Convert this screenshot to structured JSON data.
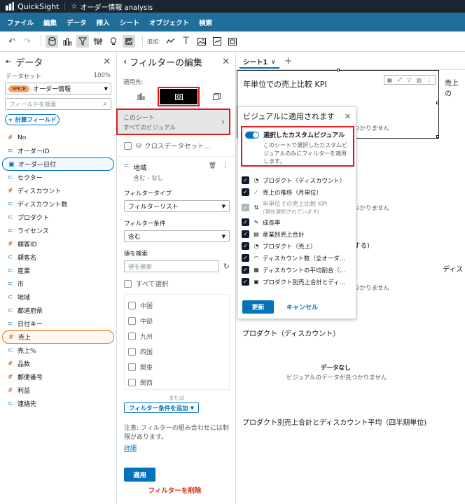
{
  "app": {
    "brand": "QuickSight",
    "analysis_title": "オーダー情報 analysis"
  },
  "menu": [
    "ファイル",
    "編集",
    "データ",
    "挿入",
    "シート",
    "オブジェクト",
    "検索"
  ],
  "toolbar": {
    "add_label": "追加:"
  },
  "data_pane": {
    "title": "データ",
    "dataset_label": "データセット",
    "dataset_pct": "100%",
    "spice_badge": "SPICE",
    "dataset_name": "オーダー情報",
    "search_placeholder": "フィールドを検索",
    "calc_button": "+ 計算フィールド",
    "fields": [
      {
        "type": "#",
        "name": "No"
      },
      {
        "type": "dim",
        "name": "オーダーID"
      },
      {
        "type": "date",
        "name": "オーダー日付",
        "selected": "blue"
      },
      {
        "type": "dim",
        "name": "セクター"
      },
      {
        "type": "#",
        "name": "ディスカウント"
      },
      {
        "type": "dim",
        "name": "ディスカウント数"
      },
      {
        "type": "dim",
        "name": "プロダクト"
      },
      {
        "type": "dim",
        "name": "ライセンス"
      },
      {
        "type": "#",
        "name": "顧客ID"
      },
      {
        "type": "dim",
        "name": "顧客名"
      },
      {
        "type": "dim",
        "name": "産業"
      },
      {
        "type": "dim",
        "name": "市"
      },
      {
        "type": "dim",
        "name": "地域"
      },
      {
        "type": "dim",
        "name": "都道府県"
      },
      {
        "type": "dim",
        "name": "日付キー"
      },
      {
        "type": "#",
        "name": "売上",
        "selected": "orange"
      },
      {
        "type": "dim",
        "name": "売上%"
      },
      {
        "type": "#",
        "name": "品数"
      },
      {
        "type": "#",
        "name": "郵便番号"
      },
      {
        "type": "#",
        "name": "利益"
      },
      {
        "type": "dim",
        "name": "連絡先"
      }
    ]
  },
  "filter_pane": {
    "title": "フィルターの編集",
    "apply_to_label": "適用先:",
    "scope_title": "このシート",
    "scope_sub": "すべてのビジュアル",
    "cross_dataset": "クロスデータセット...",
    "field_name": "地域",
    "field_sub": "含む - なし",
    "filter_type_label": "フィルタータイプ",
    "filter_type_value": "フィルターリスト",
    "filter_cond_label": "フィルター条件",
    "filter_cond_value": "含む",
    "search_values_label": "値を検索",
    "search_placeholder": "値を検索",
    "select_all": "すべて選択",
    "values": [
      "中国",
      "中部",
      "九州",
      "四国",
      "関東",
      "関西"
    ],
    "or_label": "または",
    "add_condition": "フィルター条件を追加",
    "note": "注意: フィルターの組み合わせには制限があります。",
    "note_link": "詳細",
    "apply_button": "適用",
    "delete_link": "フィルターを削除"
  },
  "canvas": {
    "sheet_tab": "シート1",
    "visual_title": "年単位での売上比較 KPI",
    "right_title_cut": "売上の",
    "no_data_title": "データなし",
    "no_data_sub": "ビジュアルのデータが見つかりません",
    "no_data_cut": "つかりません",
    "sheet_text_cut": "する)",
    "right_cut_2": "ディス",
    "product_disc_title": "プロダクト（ディスカウント）",
    "product_quarter_title": "プロダクト別売上合計とディスカウント平均（四半期単位)"
  },
  "popup": {
    "title": "ビジュアルに適用されます",
    "custom_label": "選択したカスタムビジュアル",
    "custom_desc": "このシートで選択したカスタムビジュアルのみにフィルターを適用します。",
    "visuals": [
      {
        "icon": "donut",
        "name": "プロダクト（ディスカウント）",
        "checked": true
      },
      {
        "icon": "line",
        "name": "売上の推移（月単位）",
        "checked": true
      },
      {
        "icon": "kpi",
        "name": "年単位での売上比較 KPI",
        "sub": "(現在選択されています)",
        "checked": true,
        "disabled": true
      },
      {
        "icon": "insight",
        "name": "成長率",
        "checked": true
      },
      {
        "icon": "bar",
        "name": "産業別売上合計",
        "checked": true
      },
      {
        "icon": "donut",
        "name": "プロダクト（売上）",
        "checked": true
      },
      {
        "icon": "gauge",
        "name": "ディスカウント数（全オーダ...",
        "checked": true
      },
      {
        "icon": "heat",
        "name": "ディスカウントの平均割合（...",
        "checked": true
      },
      {
        "icon": "pivot",
        "name": "プロダクト別売上合計とディ...",
        "checked": true
      }
    ],
    "update_button": "更新",
    "cancel_link": "キャンセル"
  }
}
